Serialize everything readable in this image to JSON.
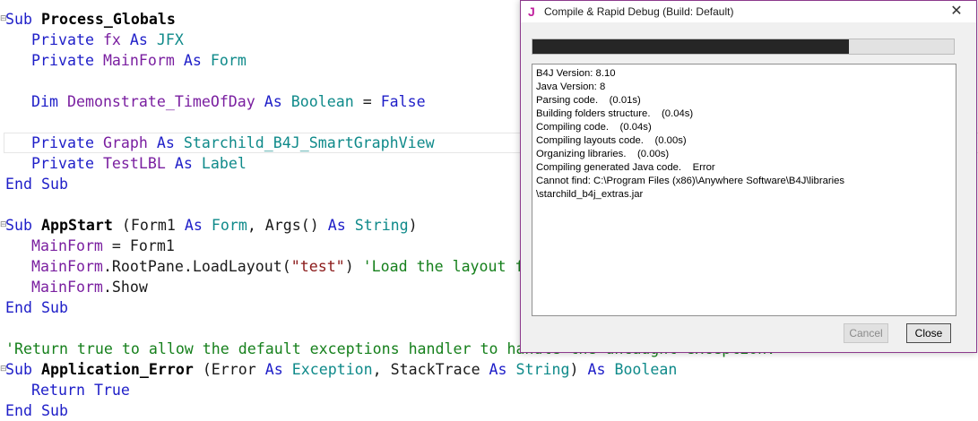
{
  "editor": {
    "lines": {
      "l1": {
        "kw1": "Sub",
        "name": "Process_Globals"
      },
      "l2": {
        "kw1": "Private",
        "var": "fx",
        "kw2": "As",
        "type": "JFX"
      },
      "l3": {
        "kw1": "Private",
        "var": "MainForm",
        "kw2": "As",
        "type": "Form"
      },
      "l5": {
        "kw1": "Dim",
        "var": "Demonstrate_TimeOfDay",
        "kw2": "As",
        "type": "Boolean",
        "op": " = ",
        "val": "False"
      },
      "l7": {
        "kw1": "Private",
        "var": "Graph",
        "kw2": "As",
        "type": "Starchild_B4J_SmartGraphView"
      },
      "l8": {
        "kw1": "Private",
        "var": "TestLBL",
        "kw2": "As",
        "type": "Label"
      },
      "l9": {
        "kw1": "End Sub"
      },
      "l11": {
        "kw1": "Sub",
        "name": "AppStart",
        "p1": " (Form1 ",
        "kw2": "As",
        "type1": "Form",
        "p2": ", Args() ",
        "kw3": "As",
        "type2": "String",
        "p3": ")"
      },
      "l12": {
        "var": "MainForm",
        "rest": " = Form1"
      },
      "l13": {
        "var": "MainForm",
        "rest": ".RootPane.LoadLayout(",
        "str": "\"test\"",
        "p": ") ",
        "cm": "'Load the layout file."
      },
      "l14": {
        "var": "MainForm",
        "rest": ".Show"
      },
      "l15": {
        "kw1": "End Sub"
      },
      "l17": {
        "cm": "'Return true to allow the default exceptions handler to handle the uncaught exception."
      },
      "l18": {
        "kw1": "Sub",
        "name": "Application_Error",
        "p1": " (Error ",
        "kw2": "As",
        "type1": "Exception",
        "p2": ", StackTrace ",
        "kw3": "As",
        "type2": "String",
        "p3": ") ",
        "kw4": "As",
        "type3": "Boolean"
      },
      "l19": {
        "kw1": "Return",
        "kw2": "True"
      },
      "l20": {
        "kw1": "End Sub"
      }
    }
  },
  "dialog": {
    "title": "Compile & Rapid Debug (Build: Default)",
    "app_icon": "J",
    "close_glyph": "✕",
    "progress": 0.75,
    "log": [
      "B4J Version: 8.10",
      "Java Version: 8",
      "Parsing code.    (0.01s)",
      "Building folders structure.    (0.04s)",
      "Compiling code.    (0.04s)",
      "Compiling layouts code.    (0.00s)",
      "Organizing libraries.    (0.00s)",
      "Compiling generated Java code.    Error",
      "Cannot find: C:\\Program Files (x86)\\Anywhere Software\\B4J\\libraries",
      "\\starchild_b4j_extras.jar"
    ],
    "buttons": {
      "cancel": "Cancel",
      "close": "Close"
    }
  },
  "colors": {
    "keyword": "#1e1ec8",
    "type": "#0f8a8a",
    "variable": "#7a1fa0",
    "comment": "#16801c",
    "accent": "#8c3a8c"
  }
}
